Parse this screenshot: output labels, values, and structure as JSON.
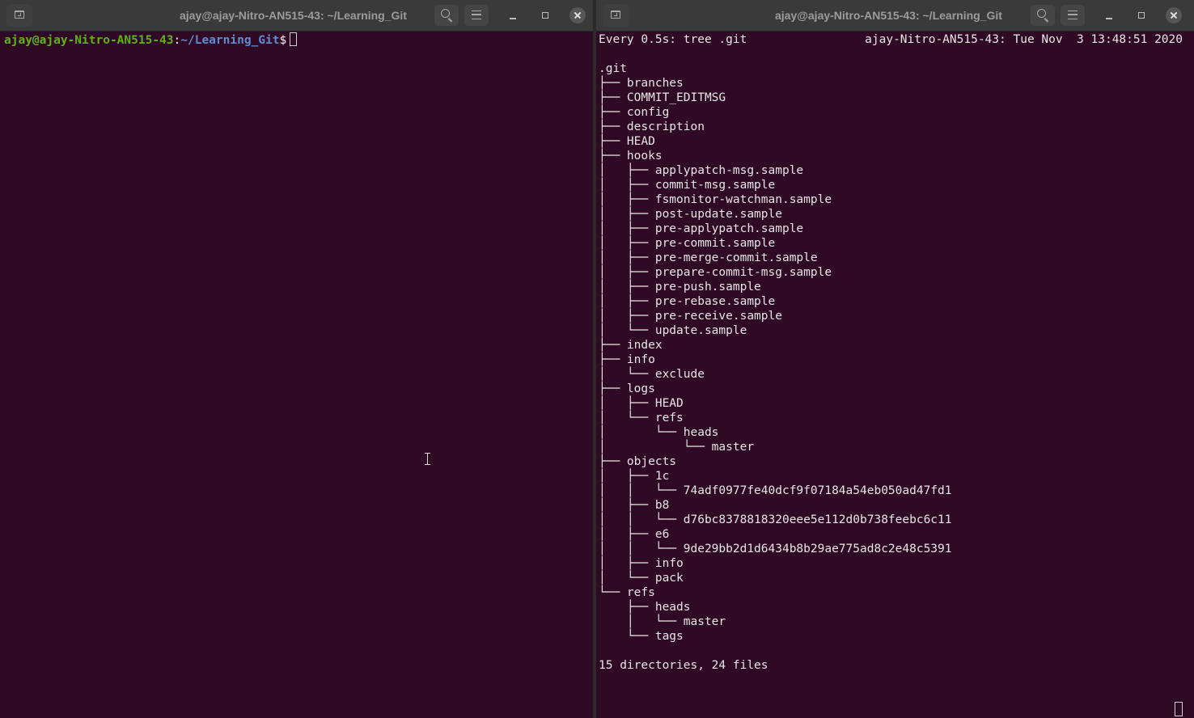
{
  "left_window": {
    "title": "ajay@ajay-Nitro-AN515-43: ~/Learning_Git",
    "prompt": {
      "user_host": "ajay@ajay-Nitro-AN515-43",
      "colon": ":",
      "path": "~/Learning_Git",
      "symbol": "$"
    }
  },
  "right_window": {
    "title": "ajay@ajay-Nitro-AN515-43: ~/Learning_Git",
    "watch": {
      "command": "Every 0.5s: tree .git",
      "status": "ajay-Nitro-AN515-43: Tue Nov  3 13:48:51 2020"
    },
    "tree": [
      ".git",
      "├── branches",
      "├── COMMIT_EDITMSG",
      "├── config",
      "├── description",
      "├── HEAD",
      "├── hooks",
      "│   ├── applypatch-msg.sample",
      "│   ├── commit-msg.sample",
      "│   ├── fsmonitor-watchman.sample",
      "│   ├── post-update.sample",
      "│   ├── pre-applypatch.sample",
      "│   ├── pre-commit.sample",
      "│   ├── pre-merge-commit.sample",
      "│   ├── prepare-commit-msg.sample",
      "│   ├── pre-push.sample",
      "│   ├── pre-rebase.sample",
      "│   ├── pre-receive.sample",
      "│   └── update.sample",
      "├── index",
      "├── info",
      "│   └── exclude",
      "├── logs",
      "│   ├── HEAD",
      "│   └── refs",
      "│       └── heads",
      "│           └── master",
      "├── objects",
      "│   ├── 1c",
      "│   │   └── 74adf0977fe40dcf9f07184a54eb050ad47fd1",
      "│   ├── b8",
      "│   │   └── d76bc8378818320eee5e112d0b738feebc6c11",
      "│   ├── e6",
      "│   │   └── 9de29bb2d1d6434b8b29ae775ad8c2e48c5391",
      "│   ├── info",
      "│   └── pack",
      "└── refs",
      "    ├── heads",
      "    │   └── master",
      "    └── tags",
      "",
      "15 directories, 24 files"
    ]
  },
  "colors": {
    "terminal_bg": "#300a24",
    "titlebar_bg": "#3a3a3a",
    "prompt_user": "#5fb31a",
    "prompt_path": "#5f8cd0"
  },
  "icons": [
    "new-tab-icon",
    "search-icon",
    "menu-icon",
    "minimize-icon",
    "maximize-icon",
    "close-icon",
    "text-cursor-icon"
  ]
}
